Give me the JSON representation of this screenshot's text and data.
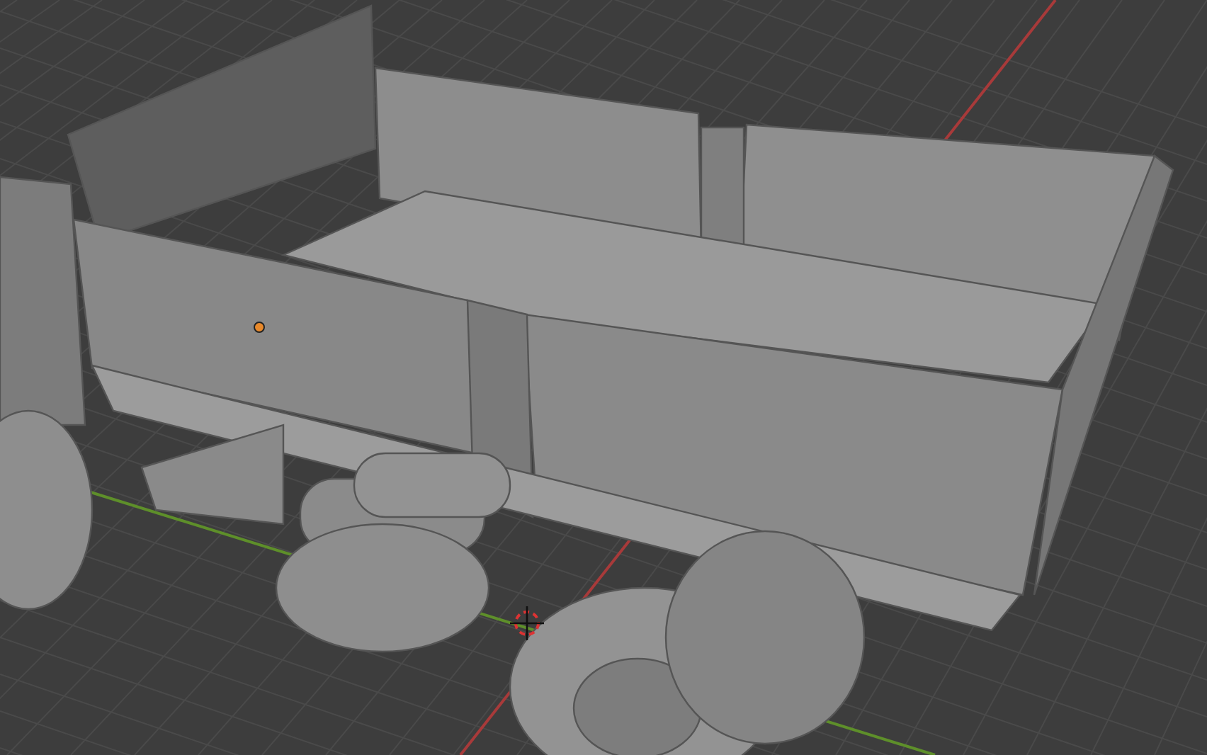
{
  "viewport": {
    "grid": true,
    "axis_lines": [
      {
        "kind": "x",
        "color": "#a83a3a"
      },
      {
        "kind": "y",
        "color": "#5e8f2a"
      }
    ],
    "origin_marker": true,
    "cursor_3d": true
  }
}
